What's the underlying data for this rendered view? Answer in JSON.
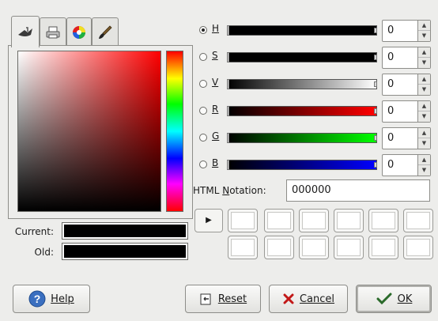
{
  "tabs": [
    {
      "icon": "scales-icon",
      "active": true
    },
    {
      "icon": "printer-icon",
      "active": false
    },
    {
      "icon": "color-wheel-icon",
      "active": false
    },
    {
      "icon": "paintbrush-icon",
      "active": false
    }
  ],
  "current_label": "Current:",
  "old_label": "Old:",
  "current_color": "#000000",
  "old_color": "#000000",
  "channels": [
    {
      "key": "h",
      "letter": "H",
      "value": "0",
      "selected": true
    },
    {
      "key": "s",
      "letter": "S",
      "value": "0",
      "selected": false
    },
    {
      "key": "v",
      "letter": "V",
      "value": "0",
      "selected": false
    },
    {
      "key": "r",
      "letter": "R",
      "value": "0",
      "selected": false
    },
    {
      "key": "g",
      "letter": "G",
      "value": "0",
      "selected": false
    },
    {
      "key": "b",
      "letter": "B",
      "value": "0",
      "selected": false
    }
  ],
  "html_notation_label": "HTML Notation:",
  "html_value": "000000",
  "history_arrow": "▶",
  "buttons": {
    "help": "Help",
    "reset": "Reset",
    "cancel": "Cancel",
    "ok": "OK"
  },
  "colors": {
    "background": "#ededeb",
    "hue_marker": "#ff0000"
  }
}
